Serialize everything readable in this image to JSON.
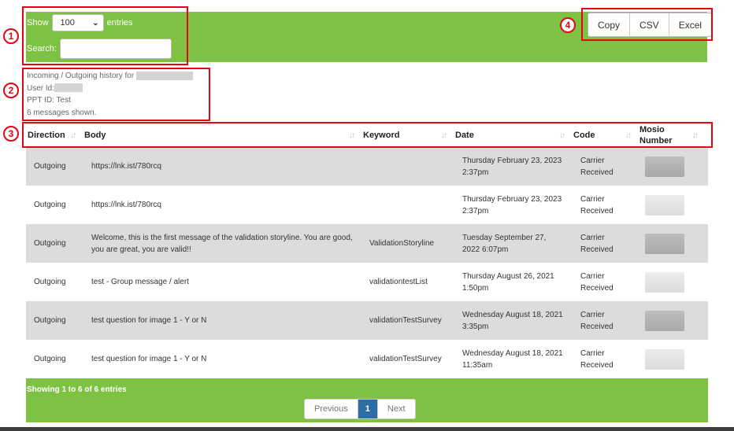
{
  "controls": {
    "show_label": "Show",
    "entries_label": "entries",
    "page_length": "100",
    "search_label": "Search:",
    "search_value": ""
  },
  "export_buttons": [
    "Copy",
    "CSV",
    "Excel"
  ],
  "info": {
    "history_label": "Incoming / Outgoing history for",
    "user_id_label": "User Id:",
    "ppt_id": "PPT ID: Test",
    "count": "6 messages shown."
  },
  "annotations": [
    "1",
    "2",
    "3",
    "4"
  ],
  "columns": [
    "Direction",
    "Body",
    "Keyword",
    "Date",
    "Code",
    "Mosio Number"
  ],
  "rows": [
    {
      "direction": "Outgoing",
      "body": "https://lnk.ist/780rcq",
      "keyword": "",
      "date": "Thursday February 23, 2023 2:37pm",
      "code": "Carrier Received"
    },
    {
      "direction": "Outgoing",
      "body": "https://lnk.ist/780rcq",
      "keyword": "",
      "date": "Thursday February 23, 2023 2:37pm",
      "code": "Carrier Received"
    },
    {
      "direction": "Outgoing",
      "body": "Welcome, this is the first message of the validation storyline. You are good, you are great, you are valid!!",
      "keyword": "ValidationStoryline",
      "date": "Tuesday September 27, 2022 6:07pm",
      "code": "Carrier Received"
    },
    {
      "direction": "Outgoing",
      "body": "test - Group message / alert",
      "keyword": "validationtestList",
      "date": "Thursday August 26, 2021 1:50pm",
      "code": "Carrier Received"
    },
    {
      "direction": "Outgoing",
      "body": "test question for image 1 - Y or N",
      "keyword": "validationTestSurvey",
      "date": "Wednesday August 18, 2021 3:35pm",
      "code": "Carrier Received"
    },
    {
      "direction": "Outgoing",
      "body": "test question for image 1 - Y or N",
      "keyword": "validationTestSurvey",
      "date": "Wednesday August 18, 2021 11:35am",
      "code": "Carrier Received"
    }
  ],
  "footer": {
    "showing": "Showing 1 to 6 of 6 entries",
    "previous": "Previous",
    "current_page": "1",
    "next": "Next"
  },
  "colors": {
    "bar_green": "#7dc242",
    "annotation_red": "#e30613",
    "active_page": "#2e6da4",
    "row_shade": "#dcdcdc"
  },
  "icons": {
    "sort": "sort-arrows-icon",
    "select": "chevron-down-icon"
  }
}
